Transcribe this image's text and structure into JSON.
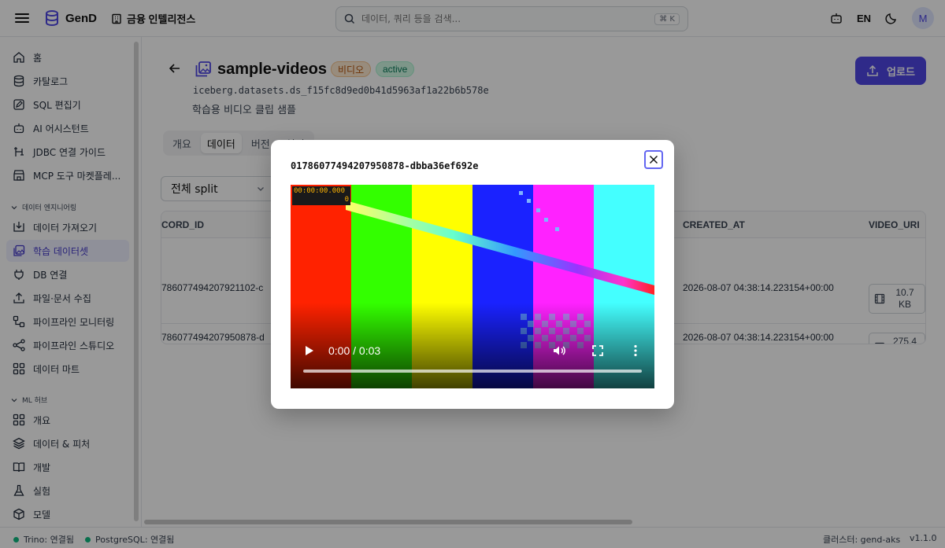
{
  "topbar": {
    "brand": "GenD",
    "org": "금융 인텔리전스",
    "search_placeholder": "데이터, 쿼리 등을 검색...",
    "search_shortcut": "⌘ K",
    "lang": "EN",
    "avatar": "M"
  },
  "sidebar": {
    "items": [
      {
        "label": "홈",
        "icon": "home-icon"
      },
      {
        "label": "카탈로그",
        "icon": "database-icon"
      },
      {
        "label": "SQL 편집기",
        "icon": "edit-icon"
      },
      {
        "label": "AI 어시스턴트",
        "icon": "bot-icon"
      },
      {
        "label": "JDBC 연결 가이드",
        "icon": "jdbc-icon"
      },
      {
        "label": "MCP 도구 마켓플레...",
        "icon": "store-icon"
      }
    ],
    "section_data_eng": "데이터 엔지니어링",
    "data_eng_items": [
      {
        "label": "데이터 가져오기",
        "icon": "import-icon"
      },
      {
        "label": "학습 데이터셋",
        "icon": "image-stack-icon",
        "active": true
      },
      {
        "label": "DB 연결",
        "icon": "plug-icon"
      },
      {
        "label": "파일·문서 수집",
        "icon": "upload-icon"
      },
      {
        "label": "파이프라인 모니터링",
        "icon": "workflow-icon"
      },
      {
        "label": "파이프라인 스튜디오",
        "icon": "share-icon"
      },
      {
        "label": "데이터 마트",
        "icon": "grid-icon"
      }
    ],
    "section_ml": "ML 허브",
    "ml_items": [
      {
        "label": "개요",
        "icon": "grid-icon"
      },
      {
        "label": "데이터 & 피처",
        "icon": "layers-icon"
      },
      {
        "label": "개발",
        "icon": "book-icon"
      },
      {
        "label": "실험",
        "icon": "flask-icon"
      },
      {
        "label": "모델",
        "icon": "box-icon"
      }
    ]
  },
  "dataset": {
    "name": "sample-videos",
    "type_badge": "비디오",
    "status_badge": "active",
    "path": "iceberg.datasets.ds_f15fc8d9ed0b41d5963af1a22b6b578e",
    "description": "학습용 비디오 클립 샘플",
    "upload_label": "업로드"
  },
  "tabs": [
    "개요",
    "데이터",
    "버전",
    "설정"
  ],
  "split_select": "전체 split",
  "table": {
    "columns": [
      "CORD_ID",
      "CREATED_AT",
      "VIDEO_URI"
    ],
    "rows": [
      {
        "record_id": "786077494207921102-c",
        "created_at": "2026-08-07 04:38:14.223154+00:00",
        "size_1": "10.7",
        "size_2": "KB"
      },
      {
        "record_id": "786077494207950878-d",
        "created_at": "2026-08-07 04:38:14.223154+00:00",
        "size_1": "275.4",
        "size_2": "KB"
      }
    ]
  },
  "statusbar": {
    "trino": "Trino: 연결됨",
    "postgres": "PostgreSQL: 연결됨",
    "cluster": "클러스터: gend-aks",
    "version": "v1.1.0"
  },
  "modal": {
    "title": "01786077494207950878-dbba36ef692e",
    "timecode": "00:00:00.000",
    "frame": "0",
    "time": "0:00 / 0:03",
    "colors": {
      "bars": [
        "#ff2200",
        "#33ff00",
        "#ffff00",
        "#1a22ff",
        "#ff22ff",
        "#44ffff"
      ]
    }
  },
  "colors": {
    "accent": "#4f46e5",
    "active_nav_bg": "#eef0ff",
    "status_ok": "#10b981"
  }
}
